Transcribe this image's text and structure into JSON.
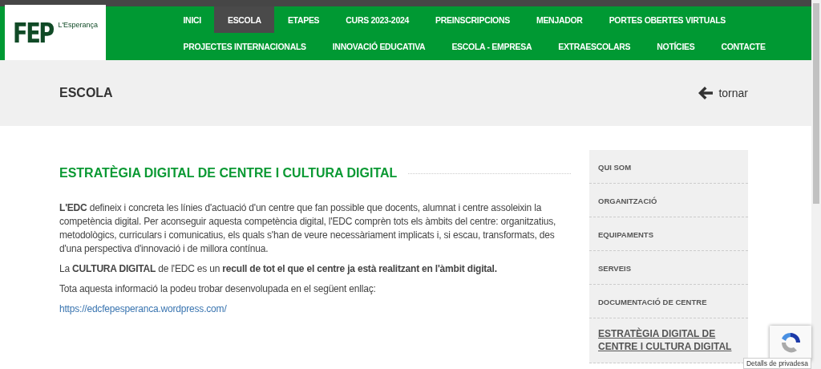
{
  "logo": {
    "mark": "FEP",
    "name": "L'Esperança"
  },
  "nav_rows": [
    [
      {
        "label": "INICI",
        "selected": false
      },
      {
        "label": "ESCOLA",
        "selected": true
      },
      {
        "label": "ETAPES",
        "selected": false
      },
      {
        "label": "CURS 2023-2024",
        "selected": false
      },
      {
        "label": "PREINSCRIPCIONS",
        "selected": false
      },
      {
        "label": "MENJADOR",
        "selected": false
      },
      {
        "label": "PORTES OBERTES VIRTUALS",
        "selected": false
      }
    ],
    [
      {
        "label": "PROJECTES INTERNACIONALS",
        "selected": false
      },
      {
        "label": "INNOVACIÓ EDUCATIVA",
        "selected": false
      },
      {
        "label": "ESCOLA - EMPRESA",
        "selected": false
      },
      {
        "label": "EXTRAESCOLARS",
        "selected": false
      },
      {
        "label": "NOTÍCIES",
        "selected": false
      },
      {
        "label": "CONTACTE",
        "selected": false
      }
    ]
  ],
  "page_title": "ESCOLA",
  "back_link": "tornar",
  "article": {
    "heading": "ESTRATÈGIA DIGITAL DE CENTRE I CULTURA DIGITAL",
    "paragraphs": [
      "**L'EDC** defineix i concreta les línies d'actuació d'un centre que fan possible que docents, alumnat i centre assoleixin la competència digital. Per aconseguir aquesta competència digital, l'EDC comprèn tots els àmbits del centre: organitzatius, metodològics, curriculars i comunicatius, els quals s'han de veure necessàriament implicats i, si escau, transformats, des d'una perspectiva d'innovació i de millora contínua.",
      "La **CULTURA DIGITAL** de l'EDC es un **recull de tot el que el centre ja està realitzant en l'àmbit digital.**",
      "Tota aquesta informació la podeu trobar desenvolupada en el següent enllaç:"
    ],
    "link": "https://edcfepesperanca.wordpress.com/"
  },
  "sidebar": [
    {
      "label": "QUI SOM",
      "selected": false
    },
    {
      "label": "ORGANITZACIÓ",
      "selected": false
    },
    {
      "label": "EQUIPAMENTS",
      "selected": false
    },
    {
      "label": "SERVEIS",
      "selected": false
    },
    {
      "label": "DOCUMENTACIÓ DE CENTRE",
      "selected": false
    },
    {
      "label": "ESTRATÈGIA DIGITAL DE CENTRE I CULTURA DIGITAL",
      "selected": true
    }
  ],
  "recaptcha": {
    "tooltip": "Detalls de privadesa"
  }
}
